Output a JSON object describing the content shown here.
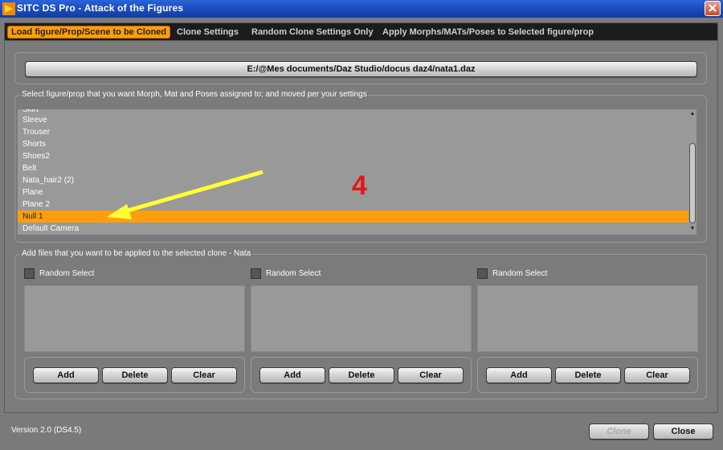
{
  "window": {
    "title": "SITC DS Pro - Attack of the Figures",
    "icon": "app-logo-icon",
    "close_icon": "close-icon"
  },
  "tabs": [
    {
      "label": "Load figure/Prop/Scene to be Cloned",
      "active": true
    },
    {
      "label": "Clone Settings",
      "active": false
    },
    {
      "label": "Random Clone Settings Only",
      "active": false
    },
    {
      "label": "Apply Morphs/MATs/Poses to Selected figure/prop",
      "active": false
    }
  ],
  "file_path_button": "E:/@Mes documents/Daz Studio/docus daz4/nata1.daz",
  "select_group": {
    "label": "Select figure/prop that you want Morph, Mat and Poses assigned to; and moved per your settings",
    "items": [
      "Skirt",
      "Sleeve",
      "Trouser",
      "Shorts",
      "Shoes2",
      "Belt",
      "Nata_hair2 (2)",
      "Plane",
      "Plane 2",
      "Null 1",
      "Default Camera"
    ],
    "selected": "Null 1"
  },
  "files_group": {
    "label": "Add files that you want to be applied to the selected clone - Nata",
    "columns": [
      {
        "random_label": "Random Select",
        "add": "Add",
        "delete": "Delete",
        "clear": "Clear"
      },
      {
        "random_label": "Random Select",
        "add": "Add",
        "delete": "Delete",
        "clear": "Clear"
      },
      {
        "random_label": "Random Select",
        "add": "Add",
        "delete": "Delete",
        "clear": "Clear"
      }
    ]
  },
  "footer": {
    "version": "Version 2.0 (DS4.5)",
    "clone_label": "Clone",
    "close_label": "Close"
  },
  "annotation": {
    "number": "4",
    "arrow_color": "#ffff33",
    "number_color": "#e8141a"
  },
  "colors": {
    "accent": "#ff9e0c",
    "titlebar": "#1948b8",
    "panel": "#7b7b7b"
  }
}
